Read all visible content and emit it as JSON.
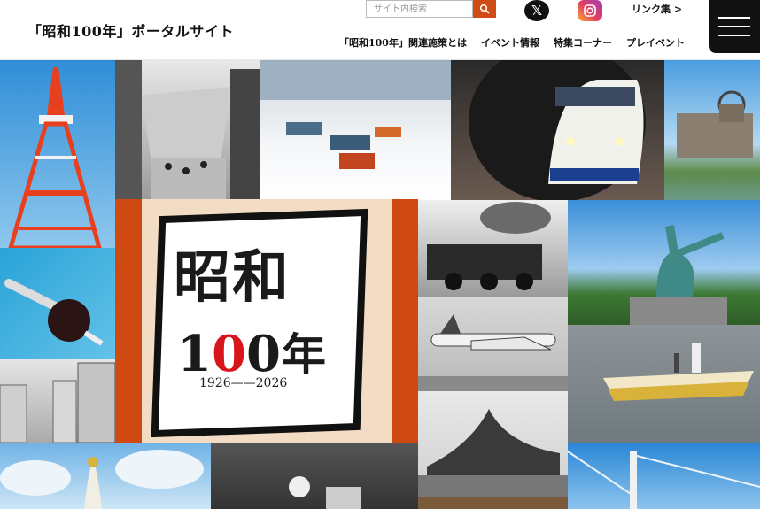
{
  "header": {
    "site_title": "「昭和100年」ポータルサイト",
    "search_placeholder": "サイト内検索",
    "links_label": "リンク集 >",
    "nav": [
      "「昭和100年」関連施策とは",
      "イベント情報",
      "特集コーナー",
      "プレイベント"
    ]
  },
  "logo": {
    "line1": "昭和",
    "num_a": "1",
    "num_b": "0",
    "num_c": "0",
    "nen": "年",
    "years": "1926——2026"
  },
  "colors": {
    "accent": "#d14b16",
    "logo_red": "#cf4a12",
    "logo_beige": "#f2dcc3",
    "dark": "#111111"
  },
  "icons": [
    "search-icon",
    "x-logo-icon",
    "instagram-icon",
    "menu-icon"
  ]
}
